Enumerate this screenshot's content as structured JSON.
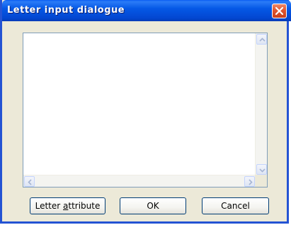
{
  "window": {
    "title": "Letter input dialogue",
    "close_icon": "close-icon"
  },
  "text_area": {
    "value": ""
  },
  "buttons": {
    "letter_attribute_pre": "Letter ",
    "letter_attribute_accel": "a",
    "letter_attribute_post": "ttribute",
    "ok": "OK",
    "cancel": "Cancel"
  },
  "colors": {
    "titlebar": "#0558e6",
    "close": "#e0552f",
    "dialog_bg": "#ece9d8",
    "button_border": "#003c74"
  }
}
